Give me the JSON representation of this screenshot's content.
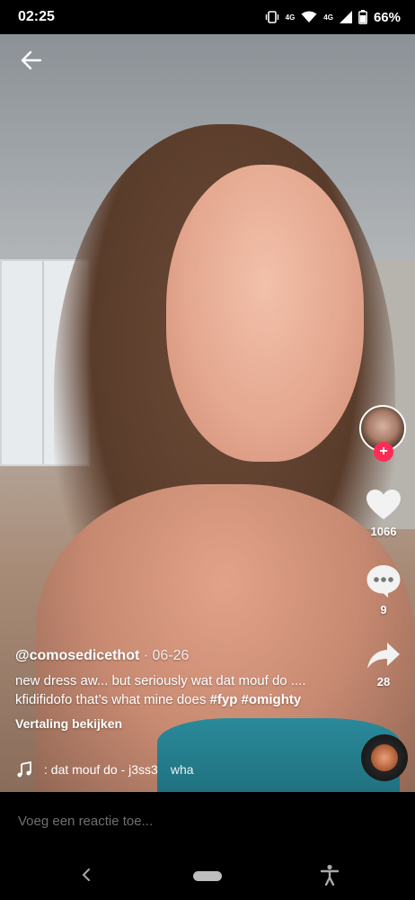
{
  "status_bar": {
    "time": "02:25",
    "network_1": "4G",
    "network_2": "4G",
    "battery": "66%",
    "icons": [
      "vibrate-icon",
      "wifi-icon",
      "signal-icon",
      "battery-icon"
    ]
  },
  "video": {
    "author_handle": "@comosedicethot",
    "date": "· 06-26",
    "caption_text": "new dress aw... but seriously wat dat mouf do .... kfidifidofo that’s what mine does",
    "hashtag_1": "#fyp",
    "hashtag_2": "#omighty",
    "translate_label": "Vertaling bekijken",
    "music_track": ": dat mouf do - j3ss3",
    "music_track_next": "wha"
  },
  "actions": {
    "like_count": "1066",
    "comment_count": "9",
    "share_count": "28",
    "follow_symbol": "+"
  },
  "comment_bar": {
    "placeholder": "Voeg een reactie toe..."
  },
  "colors": {
    "follow_accent": "#fe2c55",
    "background": "#000000",
    "placeholder": "#6f6f6f"
  }
}
